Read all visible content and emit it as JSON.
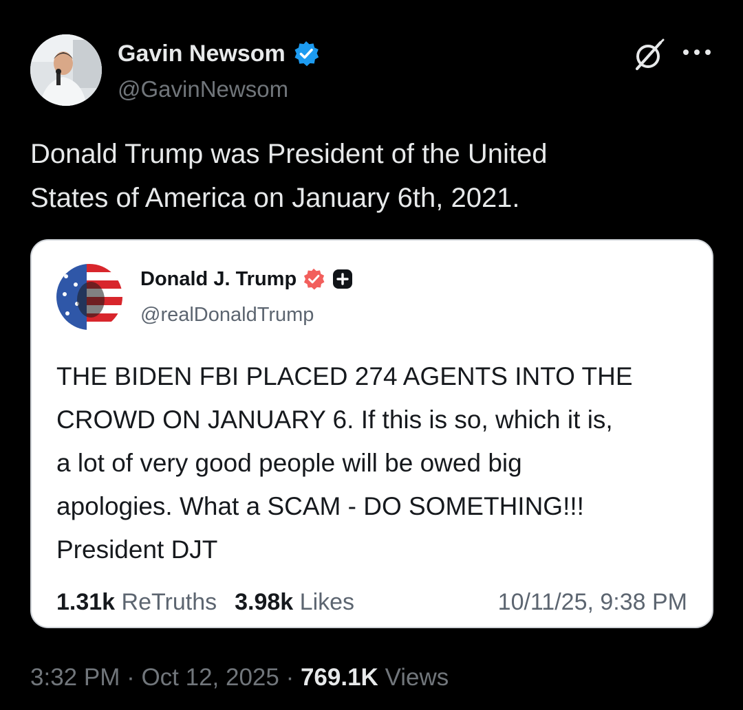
{
  "tweet": {
    "author_name": "Gavin Newsom",
    "author_handle": "@GavinNewsom",
    "verified_icon": "verified-badge-blue",
    "text_lines": [
      "Donald Trump was President of the United",
      "States of America on January 6th, 2021."
    ],
    "timestamp": "3:32 PM · Oct 12, 2025 · ",
    "views_count": "769.1K",
    "views_label": " Views"
  },
  "quoted_post": {
    "author_name": "Donald J. Trump",
    "author_handle": "@realDonaldTrump",
    "verified_icon": "verified-badge-red",
    "extra_icon": "plus-square-icon",
    "text_lines": [
      "THE BIDEN FBI PLACED 274 AGENTS INTO THE",
      "CROWD ON JANUARY 6. If this is so, which it is,",
      "a lot of very good people will be owed big",
      "apologies. What a SCAM - DO SOMETHING!!!",
      "President DJT"
    ],
    "retruths_count": "1.31k",
    "retruths_label": "ReTruths",
    "likes_count": "3.98k",
    "likes_label": "Likes",
    "date": "10/11/25, 9:38 PM"
  },
  "colors": {
    "background": "#000000",
    "primary_text": "#e7e9ea",
    "secondary_text": "#71767b",
    "verified_blue": "#1d9bf0",
    "verified_red": "#f25f5c"
  },
  "icons": [
    "grok-icon",
    "more-options-icon"
  ]
}
